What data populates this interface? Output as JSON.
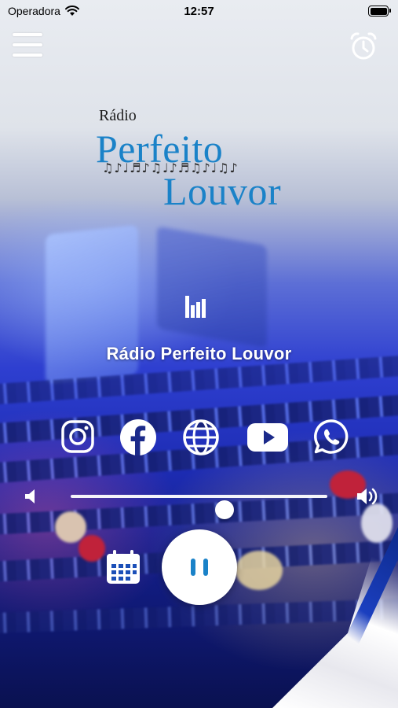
{
  "status_bar": {
    "carrier": "Operadora",
    "time": "12:57"
  },
  "header": {
    "menu_icon": "hamburger-menu-icon",
    "alarm_icon": "alarm-clock-icon"
  },
  "logo": {
    "small_text": "Rádio",
    "word1": "Perfeito",
    "word2": "Louvor",
    "notes": "♫♪♩♬♪♫♩♪♬♫♪♩♫♪"
  },
  "player": {
    "now_playing_icon": "equalizer-icon",
    "station_name": "Rádio Perfeito Louvor",
    "volume_level": 0.6,
    "play_state_icon": "pause-icon",
    "schedule_icon": "calendar-icon"
  },
  "social": [
    {
      "name": "instagram-icon"
    },
    {
      "name": "facebook-icon"
    },
    {
      "name": "website-globe-icon"
    },
    {
      "name": "youtube-icon"
    },
    {
      "name": "whatsapp-icon"
    }
  ],
  "colors": {
    "brand_blue": "#1a82c8",
    "white": "#ffffff"
  }
}
